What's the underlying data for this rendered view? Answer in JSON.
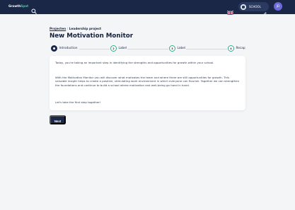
{
  "header": {
    "logo_text": "Growth",
    "logo_text_2": "Spot",
    "school_label": "SCHOOL",
    "user_initials": "JD",
    "language": "EN"
  },
  "breadcrumb": {
    "parent": "Projecten",
    "separator": "/",
    "current": "Leadership project"
  },
  "page_title": "New Motivation Monitor",
  "steps": [
    {
      "number": "1",
      "label": "Introduction",
      "active": true
    },
    {
      "number": "2",
      "label": "Label",
      "active": false
    },
    {
      "number": "3",
      "label": "Label",
      "active": false
    },
    {
      "number": "4",
      "label": "Recap",
      "active": false
    }
  ],
  "intro": {
    "paragraph_1": "Today, you're taking an important step in identifying the strengths and opportunities for growth within your school.",
    "paragraph_2": "With the Motivation Monitor you will discover what motivates the team and where there are still opportunities for growth. This valuable insight helps to create a positive, stimulating work environment in which everyone can flourish. Together we can strengthen the foundations and continue to build a school where motivation and well-being go hand in hand.",
    "paragraph_3": "Let's take the first step together!"
  },
  "actions": {
    "next_label": "Next"
  },
  "colors": {
    "navy": "#1a2746",
    "accent_green": "#37a983",
    "step_line": "#b9e6d6",
    "avatar": "#6d6bd8"
  }
}
